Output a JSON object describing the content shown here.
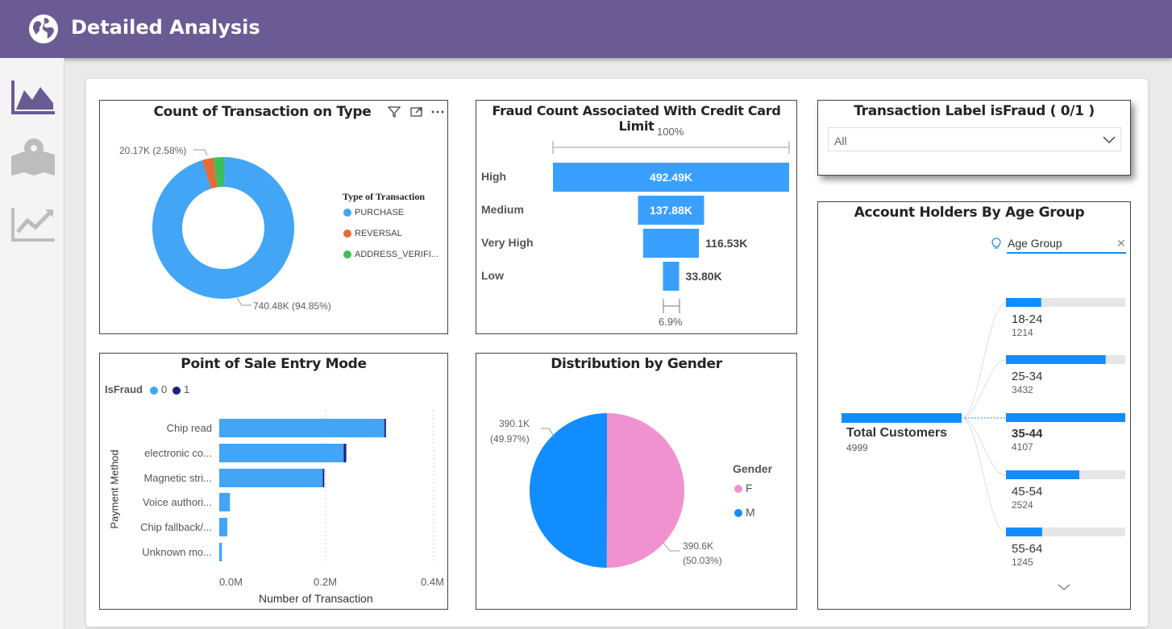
{
  "header": {
    "title": "Detailed Analysis"
  },
  "colors": {
    "header": "#6b5b95",
    "primary": "#3aa0ff",
    "bar": "#42a5f5",
    "dark": "#1a237e",
    "orange": "#e66c37",
    "green": "#3dbe5a",
    "pink": "#f092d0",
    "gender_m": "#118dff"
  },
  "sidebar": {
    "items": [
      {
        "icon": "area-chart-icon"
      },
      {
        "icon": "map-icon"
      },
      {
        "icon": "line-chart-icon"
      }
    ]
  },
  "donut": {
    "title": "Count of Transaction on Type",
    "label_small": "20.17K (2.58%)",
    "label_big": "740.48K (94.85%)",
    "legend_title": "Type of Transaction",
    "legend": [
      "PURCHASE",
      "REVERSAL",
      "ADDRESS_VERIFI..."
    ]
  },
  "funnel": {
    "title": "Fraud Count Associated With Credit Card Limit",
    "top_pct": "100%",
    "bottom_pct": "6.9%",
    "labels": [
      "High",
      "Medium",
      "Very High",
      "Low"
    ],
    "value_labels": [
      "492.49K",
      "137.88K",
      "116.53K",
      "33.80K"
    ]
  },
  "slicer": {
    "title": "Transaction Label isFraud ( 0/1 )",
    "value": "All"
  },
  "pos": {
    "title": "Point of Sale Entry Mode",
    "legend_title": "IsFraud",
    "legend": [
      "0",
      "1"
    ],
    "categories": [
      "Chip read",
      "electronic co...",
      "Magnetic stri...",
      "Voice authori...",
      "Chip fallback/...",
      "Unknown mo..."
    ],
    "ticks": [
      "0.0M",
      "0.2M",
      "0.4M"
    ],
    "xlabel": "Number of Transaction",
    "ylabel": "Payment Method"
  },
  "gender": {
    "title": "Distribution by Gender",
    "label_m_1": "390.1K",
    "label_m_2": "(49.97%)",
    "label_f_1": "390.6K",
    "label_f_2": "(50.03%)",
    "legend_title": "Gender",
    "legend": [
      "F",
      "M"
    ]
  },
  "age": {
    "title": "Account Holders By Age Group",
    "filter": "Age Group",
    "root_label": "Total Customers",
    "root_value": "4999",
    "groups": [
      {
        "label": "18-24",
        "value": "1214"
      },
      {
        "label": "25-34",
        "value": "3432"
      },
      {
        "label": "35-44",
        "value": "4107"
      },
      {
        "label": "45-54",
        "value": "2524"
      },
      {
        "label": "55-64",
        "value": "1245"
      }
    ]
  },
  "chart_data": [
    {
      "type": "pie",
      "title": "Count of Transaction on Type",
      "legend_title": "Type of Transaction",
      "categories": [
        "PURCHASE",
        "REVERSAL",
        "ADDRESS_VERIFI..."
      ],
      "values": [
        740.48,
        20.17,
        20.0
      ],
      "percentages": [
        94.85,
        2.58,
        2.57
      ],
      "unit": "K",
      "donut": true
    },
    {
      "type": "bar",
      "title": "Fraud Count Associated With Credit Card Limit",
      "categories": [
        "High",
        "Medium",
        "Very High",
        "Low"
      ],
      "values": [
        492.49,
        137.88,
        116.53,
        33.8
      ],
      "unit": "K",
      "funnel": true
    },
    {
      "type": "bar",
      "title": "Point of Sale Entry Mode",
      "orientation": "horizontal",
      "stacked": true,
      "categories": [
        "Chip read",
        "electronic co...",
        "Magnetic stri...",
        "Voice authori...",
        "Chip fallback/...",
        "Unknown mo..."
      ],
      "series": [
        {
          "name": "0",
          "values": [
            0.308,
            0.232,
            0.193,
            0.02,
            0.015,
            0.005
          ]
        },
        {
          "name": "1",
          "values": [
            0.002,
            0.005,
            0.003,
            0.0,
            0.0,
            0.0
          ]
        }
      ],
      "xlabel": "Number of Transaction",
      "ylabel": "Payment Method",
      "xlim": [
        0,
        0.4
      ],
      "legend_title": "IsFraud",
      "legend_position": "top-left"
    },
    {
      "type": "pie",
      "title": "Distribution by Gender",
      "legend_title": "Gender",
      "categories": [
        "F",
        "M"
      ],
      "values": [
        390.6,
        390.1
      ],
      "percentages": [
        50.03,
        49.97
      ],
      "unit": "K"
    },
    {
      "type": "bar",
      "title": "Account Holders By Age Group",
      "orientation": "horizontal",
      "categories": [
        "18-24",
        "25-34",
        "35-44",
        "45-54",
        "55-64"
      ],
      "values": [
        1214,
        3432,
        4107,
        2524,
        1245
      ],
      "total": 4999
    }
  ]
}
